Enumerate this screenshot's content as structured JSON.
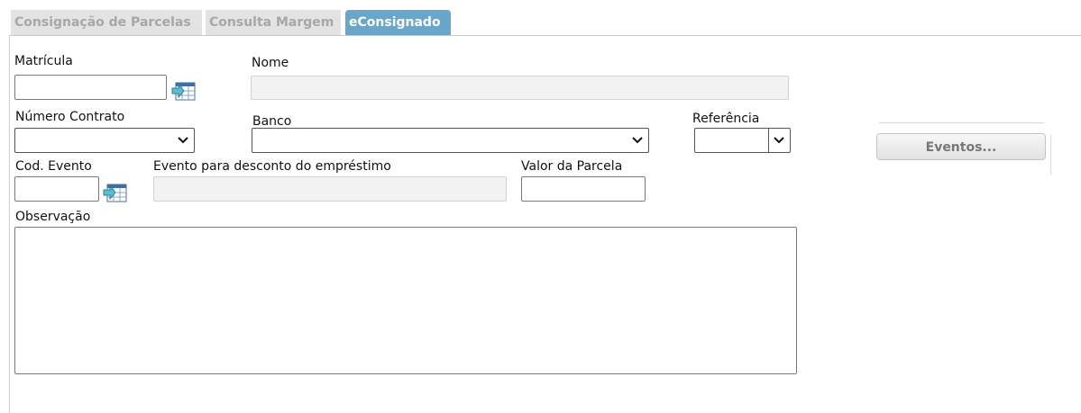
{
  "tabs": [
    {
      "label": "Consignação de Parcelas",
      "active": false
    },
    {
      "label": "Consulta Margem",
      "active": false
    },
    {
      "label": "eConsignado",
      "active": true
    }
  ],
  "form": {
    "matricula": {
      "label": "Matrícula",
      "value": ""
    },
    "nome": {
      "label": "Nome",
      "value": ""
    },
    "numero_contrato": {
      "label": "Número Contrato",
      "value": ""
    },
    "banco": {
      "label": "Banco",
      "value": ""
    },
    "referencia": {
      "label": "Referência",
      "value": ""
    },
    "cod_evento": {
      "label": "Cod. Evento",
      "value": ""
    },
    "evento_desconto": {
      "label": "Evento para desconto do empréstimo",
      "value": ""
    },
    "valor_parcela": {
      "label": "Valor da Parcela",
      "value": ""
    },
    "observacao": {
      "label": "Observação",
      "value": ""
    }
  },
  "actions": {
    "eventos_label": "Eventos..."
  },
  "icons": {
    "lookup": "table-lookup-icon",
    "dropdown": "chevron-down-icon"
  },
  "colors": {
    "active_tab": "#6aa6c9",
    "inactive_tab": "#e3e3e3",
    "inactive_tab_text": "#a7a7a7"
  }
}
